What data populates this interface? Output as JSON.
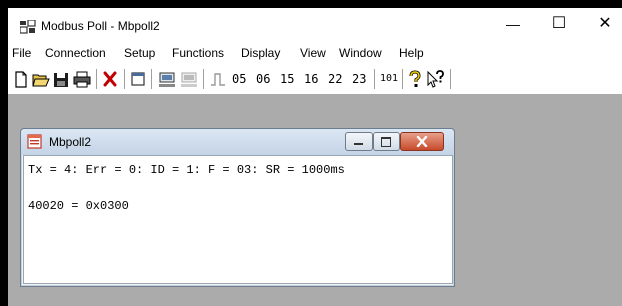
{
  "window": {
    "title": "Modbus Poll - Mbpoll2",
    "app_icon": "modbus-poll-app-icon",
    "controls": {
      "minimize": "—",
      "maximize": "☐",
      "close": "✕"
    }
  },
  "menubar": {
    "items": [
      "File",
      "Connection",
      "Setup",
      "Functions",
      "Display",
      "View",
      "Window",
      "Help"
    ]
  },
  "toolbar": {
    "icons": [
      "new-file-icon",
      "open-folder-icon",
      "save-icon",
      "print-icon",
      "delete-icon",
      "window-icon",
      "connect-icon",
      "disconnect-icon",
      "pulse-icon"
    ],
    "function_codes": [
      "05",
      "06",
      "15",
      "16",
      "22",
      "23"
    ],
    "code_101": "101",
    "help_icon": "question-mark-icon",
    "context_help_icon": "context-help-icon"
  },
  "child_window": {
    "title": "Mbpoll2",
    "status_line": "Tx = 4: Err = 0: ID = 1: F = 03: SR = 1000ms",
    "data_line": "40020 = 0x0300"
  },
  "colors": {
    "mdi_background": "#ababab",
    "close_button": "#c74a2b",
    "delete_icon": "#c00000"
  }
}
